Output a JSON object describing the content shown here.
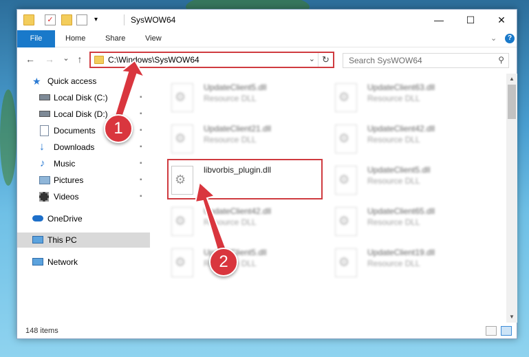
{
  "window": {
    "title": "SysWOW64",
    "minimize_glyph": "—",
    "maximize_glyph": "☐",
    "close_glyph": "✕"
  },
  "ribbon": {
    "tabs": [
      "File",
      "Home",
      "Share",
      "View"
    ],
    "help_glyph": "?",
    "expand_glyph": "⌄"
  },
  "navbar": {
    "back_glyph": "←",
    "forward_glyph": "→",
    "recent_glyph": "⌄",
    "up_glyph": "↑",
    "address": "C:\\Windows\\SysWOW64",
    "dropdown_glyph": "⌄",
    "refresh_glyph": "↻",
    "search_placeholder": "Search SysWOW64",
    "search_glyph": "⚲"
  },
  "sidebar": {
    "items": [
      {
        "label": "Quick access",
        "icon": "star-icon"
      },
      {
        "label": "Local Disk (C:)",
        "icon": "drive-icon"
      },
      {
        "label": "Local Disk (D:)",
        "icon": "drive-icon"
      },
      {
        "label": "Documents",
        "icon": "documents-icon"
      },
      {
        "label": "Downloads",
        "icon": "downloads-icon"
      },
      {
        "label": "Music",
        "icon": "music-icon"
      },
      {
        "label": "Pictures",
        "icon": "pictures-icon"
      },
      {
        "label": "Videos",
        "icon": "videos-icon"
      },
      {
        "label": "OneDrive",
        "icon": "cloud-icon"
      },
      {
        "label": "This PC",
        "icon": "computer-icon"
      },
      {
        "label": "Network",
        "icon": "network-icon"
      }
    ],
    "pin_glyph": "📌"
  },
  "files": [
    {
      "name": "UpdateClient5.dll",
      "type": "Resource DLL"
    },
    {
      "name": "UpdateClient63.dll",
      "type": "Resource DLL"
    },
    {
      "name": "UpdateClient21.dll",
      "type": "Resource DLL"
    },
    {
      "name": "UpdateClient42.dll",
      "type": "Resource DLL"
    },
    {
      "name": "libvorbis_plugin.dll",
      "type": ""
    },
    {
      "name": "UpdateClient5.dll",
      "type": "Resource DLL"
    },
    {
      "name": "UpdateClient42.dll",
      "type": "Resource DLL"
    },
    {
      "name": "UpdateClient65.dll",
      "type": "Resource DLL"
    },
    {
      "name": "UpdateClient5.dll",
      "type": "Resource DLL"
    },
    {
      "name": "UpdateClient19.dll",
      "type": "Resource DLL"
    }
  ],
  "status": {
    "items_count": "148 items"
  },
  "annotations": {
    "step1": "1",
    "step2": "2"
  },
  "colors": {
    "accent": "#1979ca",
    "highlight": "#cf3a3f",
    "badge": "#d9363e"
  }
}
